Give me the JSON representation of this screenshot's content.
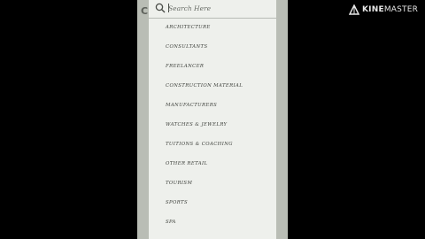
{
  "search": {
    "placeholder": "Search Here"
  },
  "background": {
    "header_letter": "C"
  },
  "items": [
    "ARCHITECTURE",
    "CONSULTANTS",
    "FREELANCER",
    "CONSTRUCTION MATERIAL",
    "MANUFACTURERS",
    "WATCHES & JEWELRY",
    "TUITIONS & COACHING",
    "OTHER RETAIL",
    "TOURISM",
    "SPORTS",
    "SPA"
  ],
  "watermark": {
    "brand_bold": "KINE",
    "brand_rest": "MASTER"
  },
  "colors": {
    "background": "#000000",
    "panel": "#eef0ec",
    "text": "#3a3d38"
  }
}
